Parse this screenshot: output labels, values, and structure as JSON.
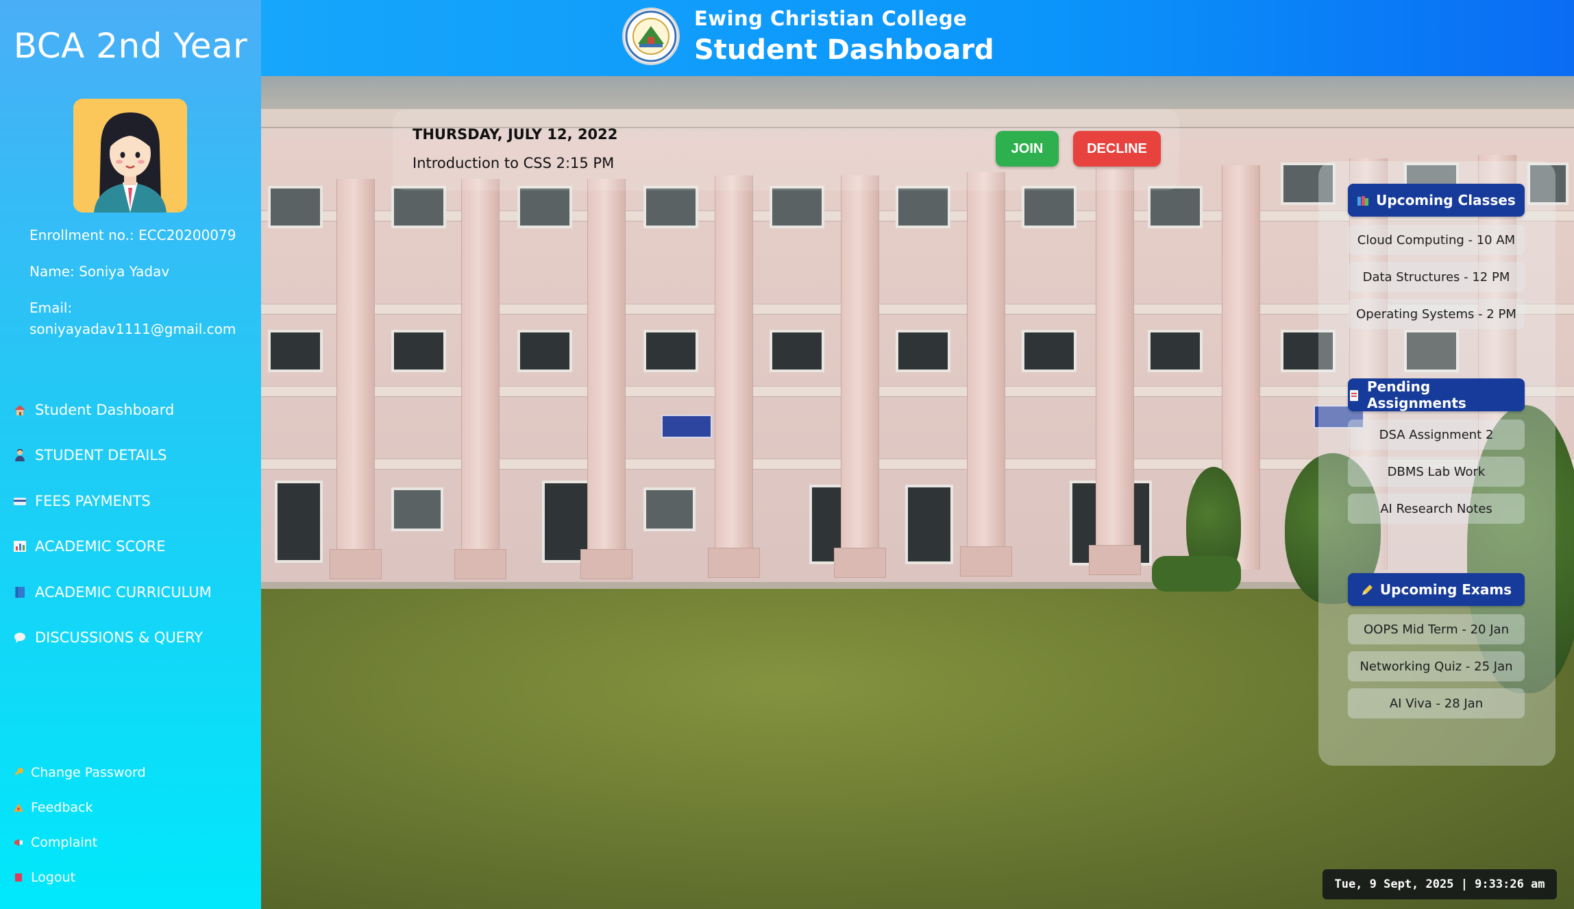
{
  "sidebar": {
    "title": "BCA 2nd Year",
    "enrollment": "Enrollment no.: ECC20200079",
    "name": "Name: Soniya Yadav",
    "email_label": "Email:",
    "email": "soniyayadav1111@gmail.com",
    "nav": [
      {
        "label": "Student Dashboard",
        "icon": "home-icon"
      },
      {
        "label": "STUDENT DETAILS",
        "icon": "student-icon"
      },
      {
        "label": "FEES PAYMENTS",
        "icon": "card-icon"
      },
      {
        "label": "ACADEMIC SCORE",
        "icon": "chart-icon"
      },
      {
        "label": "ACADEMIC CURRICULUM",
        "icon": "book-icon"
      },
      {
        "label": "DISCUSSIONS & QUERY",
        "icon": "chat-icon"
      }
    ],
    "footer": [
      {
        "label": "Change Password",
        "icon": "key-icon"
      },
      {
        "label": "Feedback",
        "icon": "feedback-icon"
      },
      {
        "label": "Complaint",
        "icon": "megaphone-icon"
      },
      {
        "label": "Logout",
        "icon": "logout-icon"
      }
    ]
  },
  "header": {
    "college": "Ewing Christian College",
    "title": "Student Dashboard"
  },
  "class_card": {
    "date": "THURSDAY, JULY 12, 2022",
    "session": "Introduction to CSS 2:15 PM",
    "join_label": "JOIN",
    "decline_label": "DECLINE"
  },
  "upcoming_classes": {
    "title": "Upcoming Classes",
    "items": [
      "Cloud Computing - 10 AM",
      "Data Structures - 12 PM",
      "Operating Systems - 2 PM"
    ]
  },
  "pending_assignments": {
    "title": "Pending Assignments",
    "items": [
      "DSA Assignment 2",
      "DBMS Lab Work",
      "AI Research Notes"
    ]
  },
  "upcoming_exams": {
    "title": "Upcoming Exams",
    "items": [
      "OOPS Mid Term - 20 Jan",
      "Networking Quiz - 25 Jan",
      "AI Viva - 28 Jan"
    ]
  },
  "clock": "Tue, 9 Sept, 2025 | 9:33:26 am",
  "colors": {
    "accent": "#173b9a",
    "join": "#2fb04f",
    "decline": "#e7423e"
  }
}
